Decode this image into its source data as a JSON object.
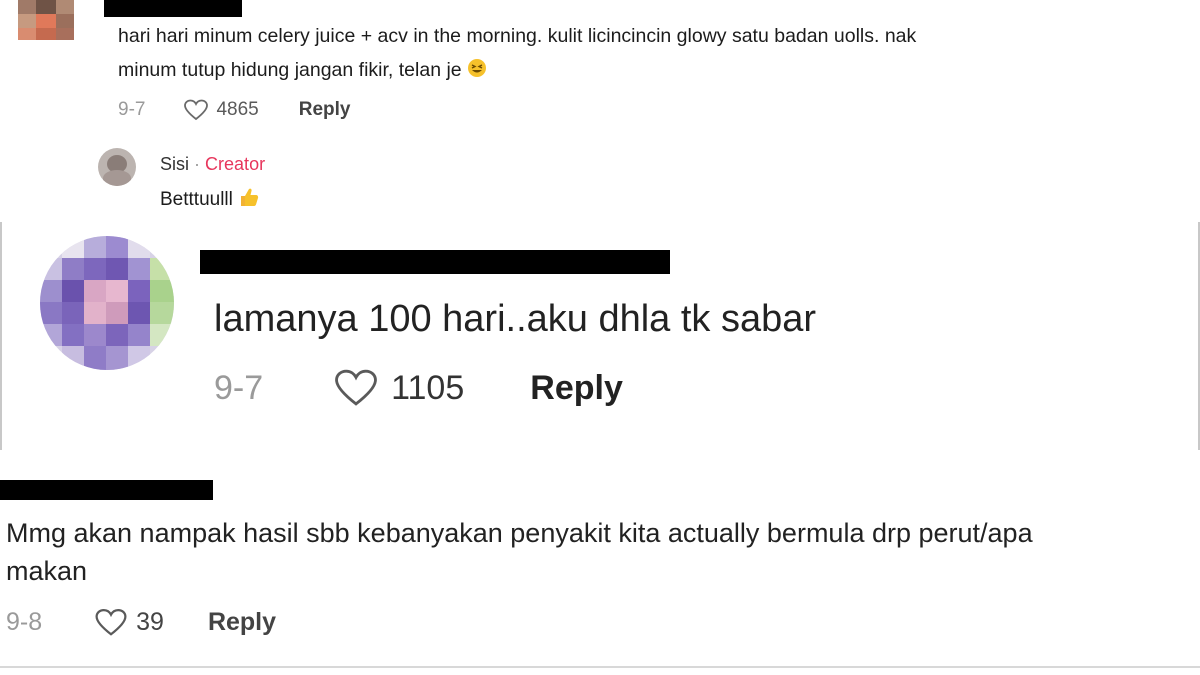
{
  "comment1": {
    "text_line1": "hari hari minum celery juice + acv in the morning. kulit licincincin glowy satu badan uolls. nak",
    "text_line2": "minum tutup hidung jangan fikir, telan je",
    "date": "9-7",
    "likes": "4865",
    "reply_label": "Reply"
  },
  "reply1": {
    "author": "Sisi",
    "separator": "·",
    "badge": "Creator",
    "text": "Betttuulll"
  },
  "comment2": {
    "text": "lamanya 100 hari..aku dhla tk sabar",
    "date": "9-7",
    "likes": "1105",
    "reply_label": "Reply"
  },
  "comment3": {
    "text_line1": "Mmg akan nampak hasil sbb kebanyakan penyakit kita actually bermula drp perut/apa",
    "text_line2": "makan",
    "date": "9-8",
    "likes": "39",
    "reply_label": "Reply"
  },
  "colors": {
    "creator_badge": "#e7365c",
    "redaction": "#000000",
    "reply_text": "#444444"
  }
}
